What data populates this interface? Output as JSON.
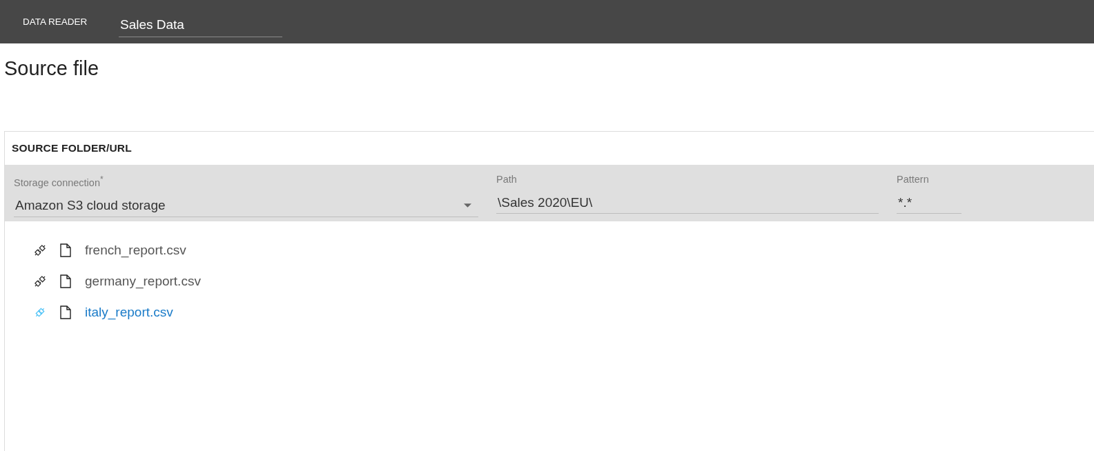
{
  "top_bar": {
    "app_name": "DATA READER",
    "title_field": {
      "value": "Sales Data"
    }
  },
  "page": {
    "heading": "Source file"
  },
  "source_panel": {
    "title": "SOURCE FOLDER/URL",
    "fields": [
      {
        "kind": "dropdown",
        "label": "Storage connection$^{*}$",
        "value": "Amazon S3 cloud storage"
      },
      {
        "kind": "text",
        "label": "Path",
        "value": "\\Sales 2020\\EU\\"
      },
      {
        "kind": "text",
        "label": "Pattern",
        "value": "*.*"
      }
    ],
    "files": [
      {
        "name": "french_report.csv",
        "connected": false,
        "selected": false
      },
      {
        "name": "germany_report.csv",
        "connected": false,
        "selected": false
      },
      {
        "name": "italy_report.csv",
        "connected": true,
        "selected": true
      }
    ]
  }
}
